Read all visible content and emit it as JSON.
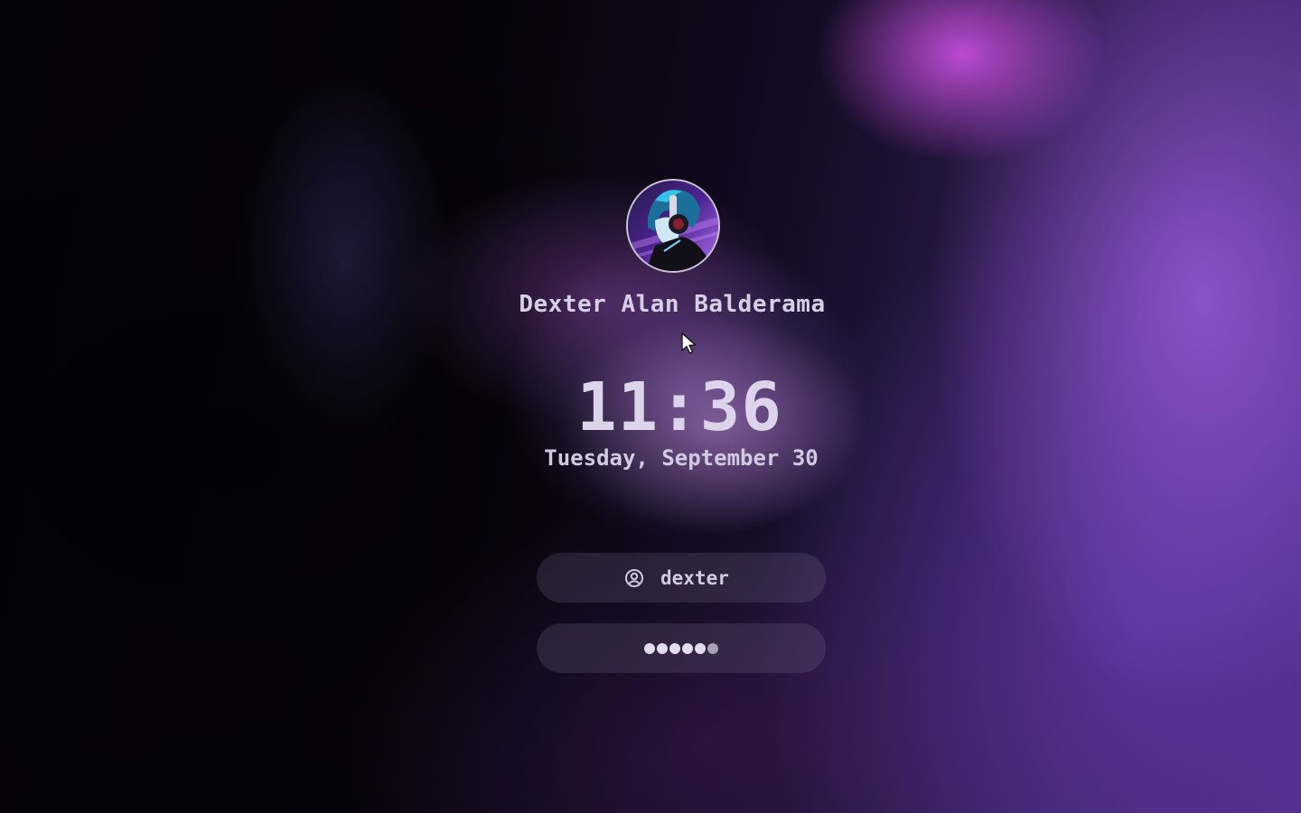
{
  "lock_screen": {
    "full_name": "Dexter Alan Balderama",
    "time": "11:36",
    "date": "Tuesday, September 30",
    "username_field": {
      "icon": "user-circle-icon",
      "value": "dexter"
    },
    "password_field": {
      "masked_char_count": 6
    },
    "avatar": {
      "icon": "profile-avatar"
    }
  },
  "colors": {
    "accent": "#9b5de5",
    "text": "#d8cfe6",
    "field_bg": "#3a3346"
  }
}
